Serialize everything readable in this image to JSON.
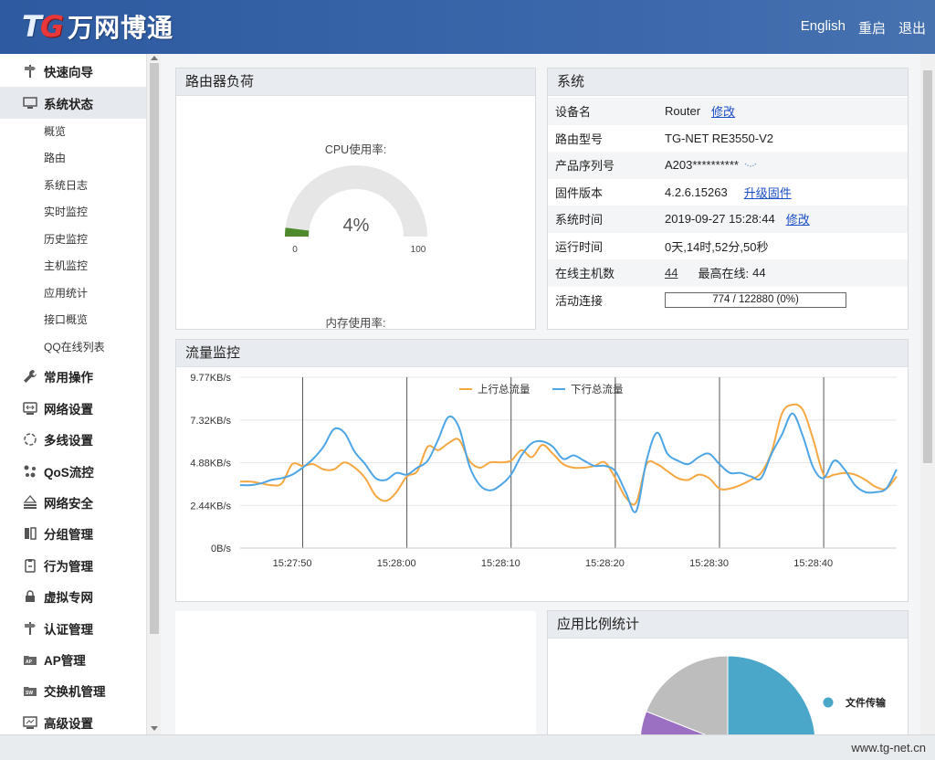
{
  "header": {
    "logo_tg_t": "T",
    "logo_tg_g": "G",
    "logo_cn": "万网博通",
    "links": [
      "English",
      "重启",
      "退出"
    ]
  },
  "sidebar": {
    "groups": [
      {
        "label": "快速向导",
        "icon": "signpost-icon"
      },
      {
        "label": "系统状态",
        "icon": "monitor-icon",
        "active": true,
        "items": [
          "概览",
          "路由",
          "系统日志",
          "实时监控",
          "历史监控",
          "主机监控",
          "应用统计",
          "接口概览",
          "QQ在线列表"
        ]
      },
      {
        "label": "常用操作",
        "icon": "wrench-icon"
      },
      {
        "label": "网络设置",
        "icon": "network-icon"
      },
      {
        "label": "多线设置",
        "icon": "multiline-icon"
      },
      {
        "label": "QoS流控",
        "icon": "qos-icon"
      },
      {
        "label": "网络安全",
        "icon": "firewall-icon"
      },
      {
        "label": "分组管理",
        "icon": "group-icon"
      },
      {
        "label": "行为管理",
        "icon": "behavior-icon"
      },
      {
        "label": "虚拟专网",
        "icon": "lock-icon"
      },
      {
        "label": "认证管理",
        "icon": "auth-icon"
      },
      {
        "label": "AP管理",
        "icon": "ap-folder-icon"
      },
      {
        "label": "交换机管理",
        "icon": "switch-folder-icon"
      },
      {
        "label": "高级设置",
        "icon": "advanced-icon"
      }
    ]
  },
  "load_panel": {
    "title": "路由器负荷",
    "cpu_label": "CPU使用率:",
    "cpu_value": "4%",
    "cpu_fraction": 0.04,
    "gauge_min": "0",
    "gauge_max": "100",
    "mem_label": "内存使用率:",
    "colors": {
      "track": "#e6e6e6",
      "fill": "#4e8a2c"
    }
  },
  "system_panel": {
    "title": "系统",
    "rows": [
      {
        "key": "设备名",
        "value": "Router",
        "link": "修改"
      },
      {
        "key": "路由型号",
        "value": "TG-NET RE3550-V2"
      },
      {
        "key": "产品序列号",
        "value": "A203**********"
      },
      {
        "key": "固件版本",
        "value": "4.2.6.15263",
        "link": "升级固件"
      },
      {
        "key": "系统时间",
        "value": "2019-09-27 15:28:44",
        "link": "修改"
      },
      {
        "key": "运行时间",
        "value": "0天,14时,52分,50秒"
      },
      {
        "key": "在线主机数",
        "value": "44",
        "extra_label": "最高在线:",
        "extra_value": "44"
      },
      {
        "key": "活动连接",
        "value": "774 / 122880 (0%)"
      }
    ]
  },
  "traffic_panel": {
    "title": "流量监控"
  },
  "chart_data": {
    "type": "line",
    "ytick_labels": [
      "0B/s",
      "2.44KB/s",
      "4.88KB/s",
      "7.32KB/s",
      "9.77KB/s"
    ],
    "ylim": [
      0,
      9.77
    ],
    "yticks": [
      0,
      2.44,
      4.88,
      7.32,
      9.77
    ],
    "xlim": [
      0,
      37.2
    ],
    "xticks": [
      5,
      15,
      25,
      35,
      45,
      55
    ],
    "xtick_labels": [
      "15:27:50",
      "15:28:00",
      "15:28:10",
      "15:28:20",
      "15:28:30",
      "15:28:40"
    ],
    "vlines": [
      6,
      16,
      26,
      36,
      46,
      56
    ],
    "legend_position": "top",
    "series": [
      {
        "name": "上行总流量",
        "color": "#f5a742",
        "values": [
          [
            0,
            3.8
          ],
          [
            1,
            3.8
          ],
          [
            2,
            3.7
          ],
          [
            3,
            3.6
          ],
          [
            4,
            3.7
          ],
          [
            5,
            4.8
          ],
          [
            6,
            4.7
          ],
          [
            7,
            4.8
          ],
          [
            8,
            4.5
          ],
          [
            9,
            4.5
          ],
          [
            10,
            4.9
          ],
          [
            11,
            4.6
          ],
          [
            12,
            4.0
          ],
          [
            13,
            3.0
          ],
          [
            14,
            2.7
          ],
          [
            15,
            3.2
          ],
          [
            16,
            4.1
          ],
          [
            17,
            4.4
          ],
          [
            18,
            5.8
          ],
          [
            19,
            5.6
          ],
          [
            20,
            6.0
          ],
          [
            21,
            6.2
          ],
          [
            22,
            5.0
          ],
          [
            23,
            4.6
          ],
          [
            24,
            4.9
          ],
          [
            25,
            4.9
          ],
          [
            26,
            5.0
          ],
          [
            27,
            5.6
          ],
          [
            28,
            5.2
          ],
          [
            29,
            5.9
          ],
          [
            30,
            5.4
          ],
          [
            31,
            4.8
          ],
          [
            32,
            4.6
          ],
          [
            33,
            4.6
          ],
          [
            34,
            4.7
          ],
          [
            35,
            4.9
          ],
          [
            36,
            4.0
          ],
          [
            37,
            2.9
          ],
          [
            38,
            2.6
          ],
          [
            39,
            4.8
          ],
          [
            40,
            4.8
          ],
          [
            41,
            4.4
          ],
          [
            42,
            4.0
          ],
          [
            43,
            3.9
          ],
          [
            44,
            4.2
          ],
          [
            45,
            4.0
          ],
          [
            46,
            3.4
          ],
          [
            47,
            3.4
          ],
          [
            48,
            3.6
          ],
          [
            49,
            3.9
          ],
          [
            50,
            4.3
          ],
          [
            51,
            5.5
          ],
          [
            52,
            7.7
          ],
          [
            53,
            8.2
          ],
          [
            54,
            7.9
          ],
          [
            55,
            6.2
          ],
          [
            56,
            4.2
          ],
          [
            57,
            4.2
          ],
          [
            58,
            4.3
          ],
          [
            59,
            4.2
          ],
          [
            60,
            3.9
          ],
          [
            61,
            3.5
          ],
          [
            62,
            3.4
          ],
          [
            63,
            4.1
          ]
        ]
      },
      {
        "name": "下行总流量",
        "color": "#4ea5e6",
        "values": [
          [
            0,
            3.6
          ],
          [
            1,
            3.6
          ],
          [
            2,
            3.7
          ],
          [
            3,
            3.9
          ],
          [
            4,
            4.0
          ],
          [
            5,
            4.2
          ],
          [
            6,
            4.6
          ],
          [
            7,
            5.1
          ],
          [
            8,
            5.8
          ],
          [
            9,
            6.8
          ],
          [
            10,
            6.6
          ],
          [
            11,
            5.5
          ],
          [
            12,
            4.8
          ],
          [
            13,
            4.0
          ],
          [
            14,
            3.9
          ],
          [
            15,
            4.3
          ],
          [
            16,
            4.2
          ],
          [
            17,
            4.6
          ],
          [
            18,
            5.0
          ],
          [
            19,
            6.2
          ],
          [
            20,
            7.5
          ],
          [
            21,
            6.9
          ],
          [
            22,
            4.7
          ],
          [
            23,
            3.6
          ],
          [
            24,
            3.3
          ],
          [
            25,
            3.6
          ],
          [
            26,
            4.2
          ],
          [
            27,
            5.3
          ],
          [
            28,
            6.0
          ],
          [
            29,
            6.1
          ],
          [
            30,
            5.8
          ],
          [
            31,
            5.1
          ],
          [
            32,
            5.3
          ],
          [
            33,
            5.0
          ],
          [
            34,
            4.7
          ],
          [
            35,
            4.7
          ],
          [
            36,
            4.4
          ],
          [
            37,
            3.2
          ],
          [
            38,
            2.1
          ],
          [
            39,
            5.0
          ],
          [
            40,
            6.6
          ],
          [
            41,
            5.4
          ],
          [
            42,
            5.0
          ],
          [
            43,
            4.8
          ],
          [
            44,
            5.2
          ],
          [
            45,
            5.4
          ],
          [
            46,
            4.8
          ],
          [
            47,
            4.3
          ],
          [
            48,
            4.3
          ],
          [
            49,
            4.1
          ],
          [
            50,
            4.0
          ],
          [
            51,
            5.4
          ],
          [
            52,
            6.5
          ],
          [
            53,
            7.7
          ],
          [
            54,
            6.4
          ],
          [
            55,
            4.6
          ],
          [
            56,
            4.0
          ],
          [
            57,
            5.0
          ],
          [
            58,
            4.5
          ],
          [
            59,
            3.6
          ],
          [
            60,
            3.2
          ],
          [
            61,
            3.2
          ],
          [
            62,
            3.4
          ],
          [
            63,
            4.5
          ]
        ]
      }
    ]
  },
  "app_panel": {
    "title": "应用比例统计",
    "legend": [
      {
        "label": "文件传输",
        "color": "#4aa7c9"
      }
    ],
    "slice_colors": [
      "#4aa7c9",
      "#9b6fc2",
      "#bdbdbd"
    ]
  },
  "footer": {
    "site": "www.tg-net.cn"
  }
}
